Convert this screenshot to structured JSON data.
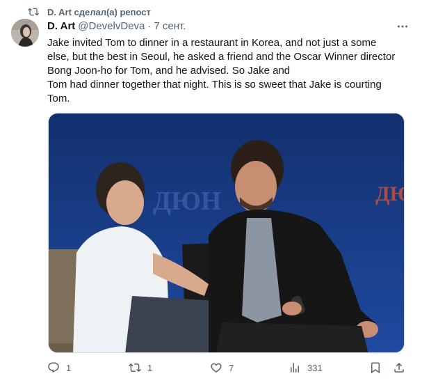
{
  "repost": {
    "text": "D. Art сделал(а) репост",
    "icon": "repost-icon"
  },
  "author": {
    "name": "D. Art",
    "handle": "@DevelvDeva",
    "separator": "·",
    "date": "7 сент."
  },
  "tweet": {
    "lines": [
      "Jake invited Tom to dinner in a restaurant in Korea, and not just a some",
      "else, but the best in Seoul, he asked a friend and the Oscar Winner director",
      "Bong Joon-ho for Tom, and he advised. So Jake and",
      "Tom had dinner together that night. This is so sweet that Jake is courting",
      "Tom."
    ]
  },
  "media": {
    "backdrop_text": "ДЮН",
    "backdrop_color": "#1c3f86"
  },
  "actions": {
    "replies": "1",
    "reposts": "1",
    "likes": "7",
    "views": "331"
  },
  "colors": {
    "text": "#0f1419",
    "secondary": "#536471",
    "border": "#cfd9de"
  }
}
